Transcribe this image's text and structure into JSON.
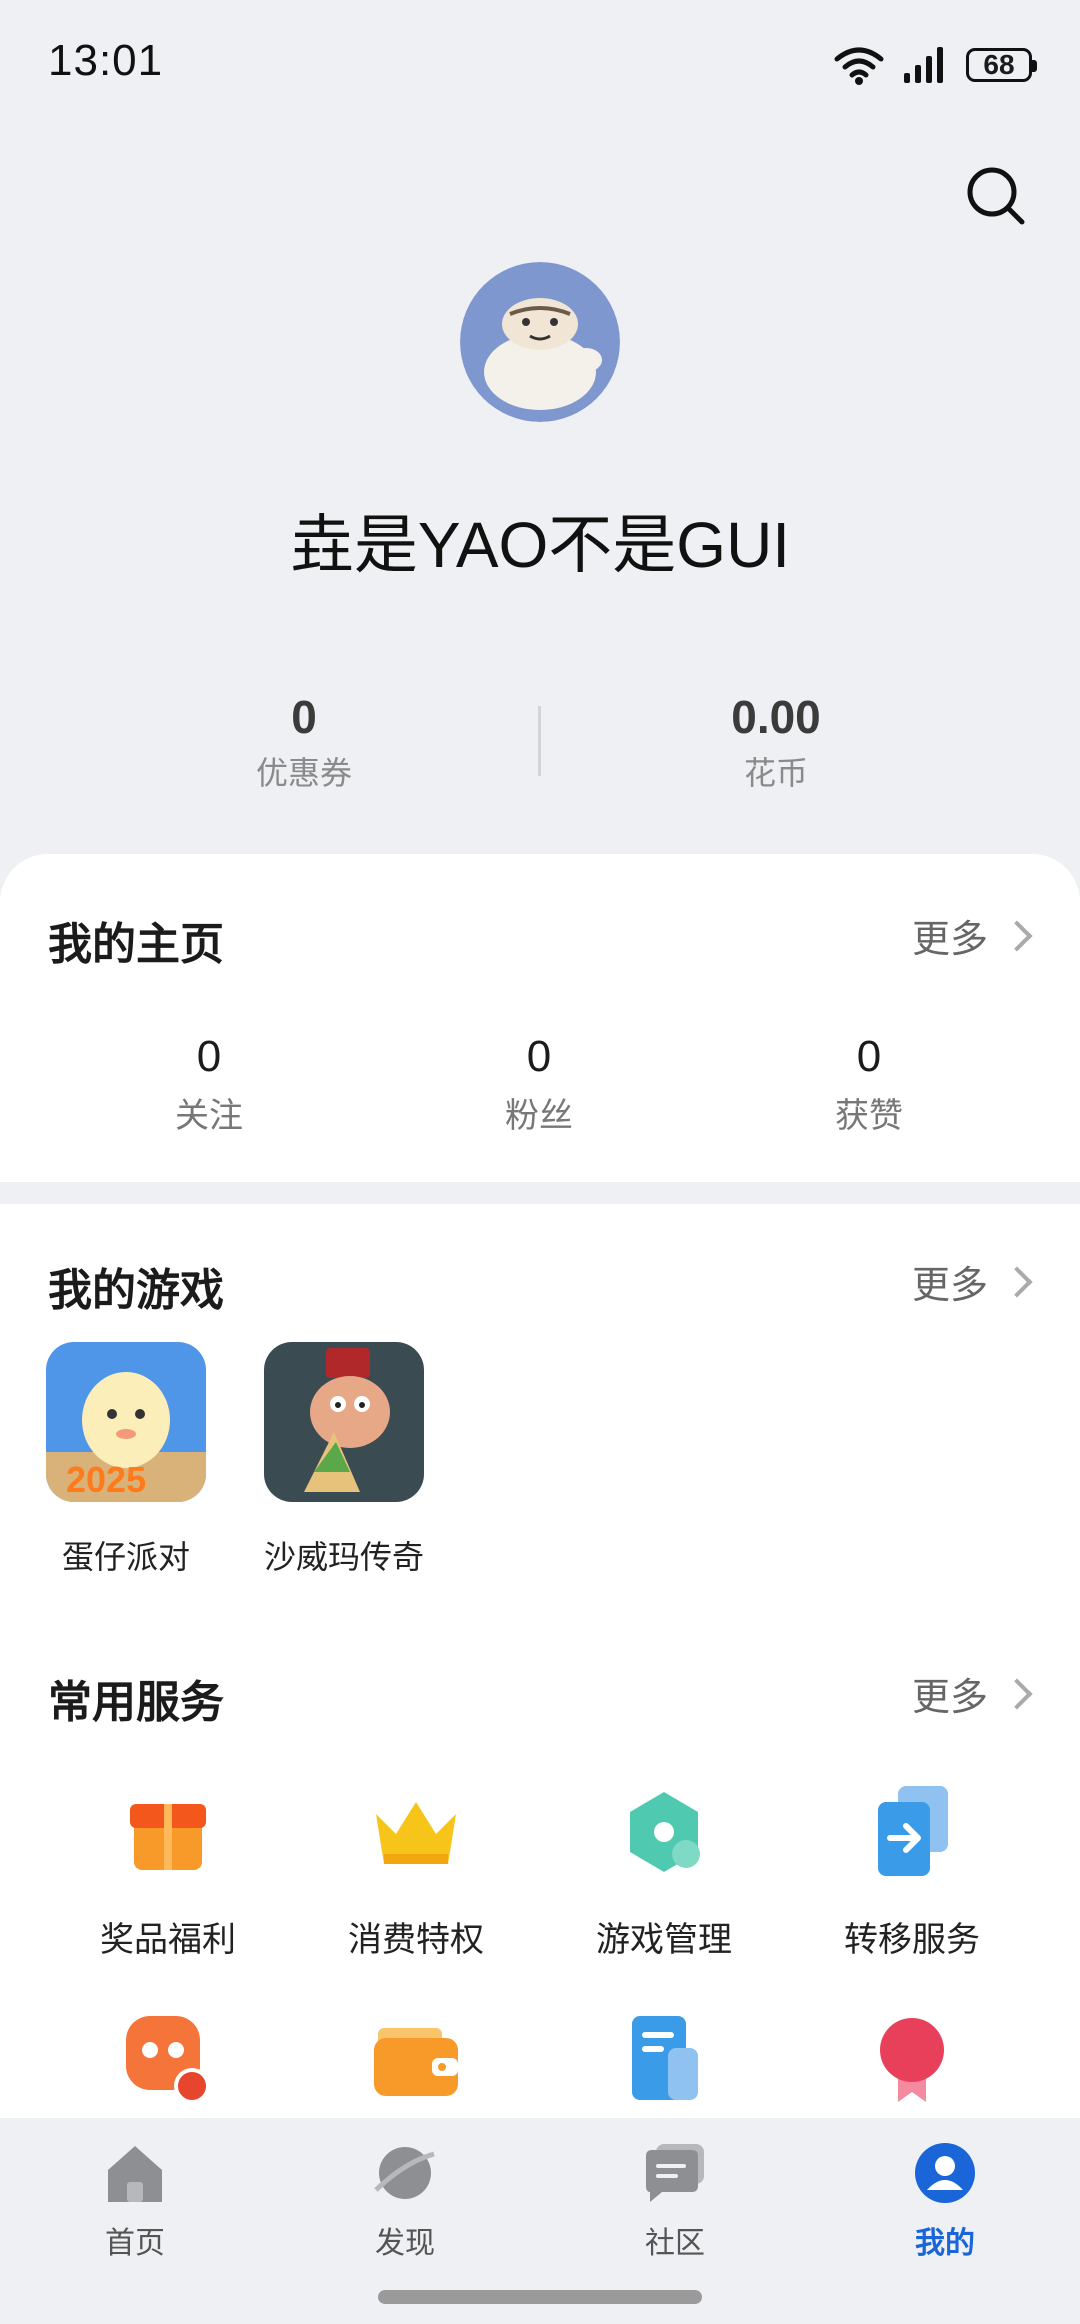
{
  "status": {
    "time": "13:01",
    "battery": "68"
  },
  "profile": {
    "username": "垚是YAO不是GUI"
  },
  "stats": [
    {
      "value": "0",
      "label": "优惠券"
    },
    {
      "value": "0.00",
      "label": "花币"
    }
  ],
  "homepage": {
    "title": "我的主页",
    "more": "更多",
    "counts": [
      {
        "value": "0",
        "label": "关注"
      },
      {
        "value": "0",
        "label": "粉丝"
      },
      {
        "value": "0",
        "label": "获赞"
      }
    ]
  },
  "games": {
    "title": "我的游戏",
    "more": "更多",
    "items": [
      {
        "name": "蛋仔派对"
      },
      {
        "name": "沙威玛传奇"
      }
    ]
  },
  "services": {
    "title": "常用服务",
    "more": "更多",
    "items": [
      {
        "label": "奖品福利",
        "icon": "gift-icon"
      },
      {
        "label": "消费特权",
        "icon": "crown-icon"
      },
      {
        "label": "游戏管理",
        "icon": "game-manage-icon"
      },
      {
        "label": "转移服务",
        "icon": "transfer-icon"
      },
      {
        "icon": "service-coin-icon"
      },
      {
        "icon": "wallet-icon"
      },
      {
        "icon": "document-icon"
      },
      {
        "icon": "badge-icon"
      }
    ]
  },
  "tabs": [
    {
      "label": "首页",
      "icon": "home-icon"
    },
    {
      "label": "发现",
      "icon": "planet-icon"
    },
    {
      "label": "社区",
      "icon": "chat-icon"
    },
    {
      "label": "我的",
      "icon": "person-icon",
      "active": true
    }
  ],
  "colors": {
    "accent": "#1a66d8",
    "background": "#eef0f4"
  }
}
